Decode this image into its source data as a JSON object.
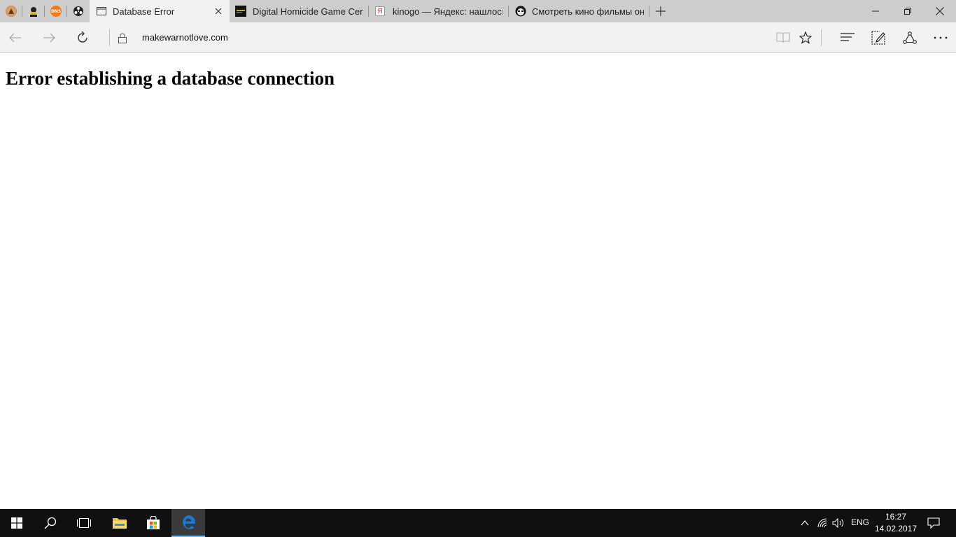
{
  "browser": {
    "pinned_tabs": [
      {
        "icon": "avatar-favicon-icon"
      },
      {
        "icon": "anime-favicon-icon"
      },
      {
        "icon": "dns-favicon-icon",
        "text": "DNS"
      },
      {
        "icon": "film-reel-favicon-icon"
      }
    ],
    "tabs": [
      {
        "label": "Database Error",
        "active": true
      },
      {
        "label": "Digital Homicide Game Cen"
      },
      {
        "label": "kinogo — Яндекс: нашлось"
      },
      {
        "label": "Смотреть кино фильмы он"
      }
    ],
    "address": "makewarnotlove.com",
    "colors": {
      "tabbar": "#cdcdcd",
      "toolbar": "#f2f2f2",
      "taskbar": "#101010",
      "edge_blue": "#1a77d2",
      "dns_orange": "#f27a1a",
      "yandex_red": "#e52620"
    }
  },
  "page": {
    "heading": "Error establishing a database connection"
  },
  "taskbar": {
    "language": "ENG",
    "time": "16:27",
    "date": "14.02.2017"
  }
}
